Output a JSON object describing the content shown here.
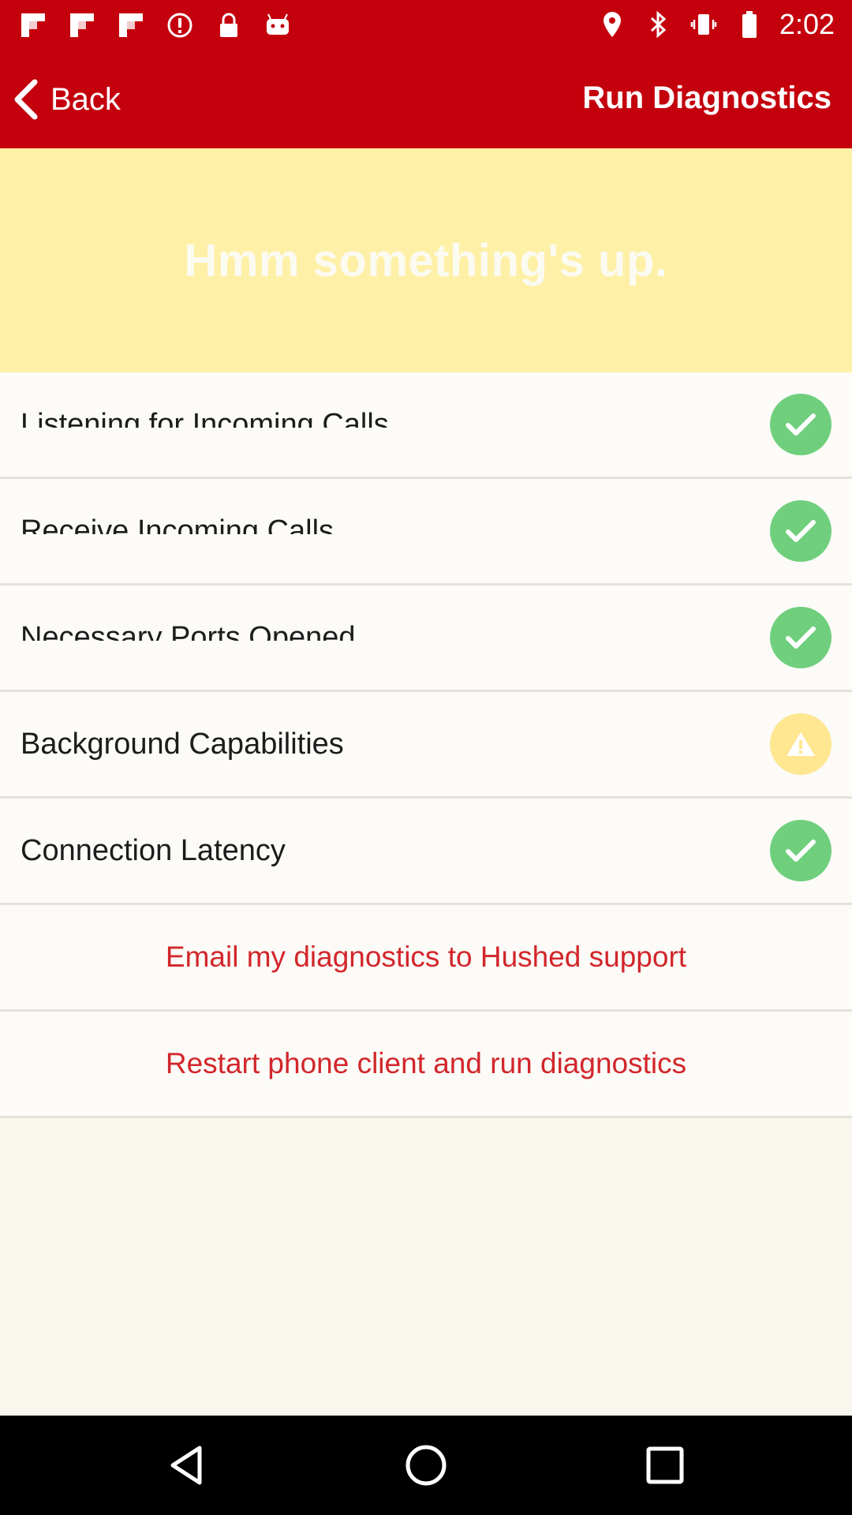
{
  "status_bar": {
    "time": "2:02",
    "left_icons": [
      "flipboard-icon",
      "flipboard-icon",
      "flipboard-icon",
      "alert-icon",
      "lock-icon",
      "android-icon"
    ],
    "right_icons": [
      "location-icon",
      "bluetooth-icon",
      "vibrate-icon",
      "battery-icon"
    ]
  },
  "app_bar": {
    "back_label": "Back",
    "title": "Run Diagnostics",
    "color": "#c4000d"
  },
  "banner": {
    "message": "Hmm something's up.",
    "color": "#fff0a8"
  },
  "checks": [
    {
      "label": "Listening for Incoming Calls",
      "status": "ok"
    },
    {
      "label": "Receive Incoming Calls",
      "status": "ok"
    },
    {
      "label": "Necessary Ports Opened",
      "status": "ok"
    },
    {
      "label": "Background Capabilities",
      "status": "warning"
    },
    {
      "label": "Connection Latency",
      "status": "ok"
    }
  ],
  "actions": {
    "email": "Email my diagnostics to Hushed support",
    "restart": "Restart phone client and run diagnostics"
  },
  "colors": {
    "ok": "#6fcf7d",
    "warning": "#ffe690",
    "action_text": "#d2262b"
  }
}
